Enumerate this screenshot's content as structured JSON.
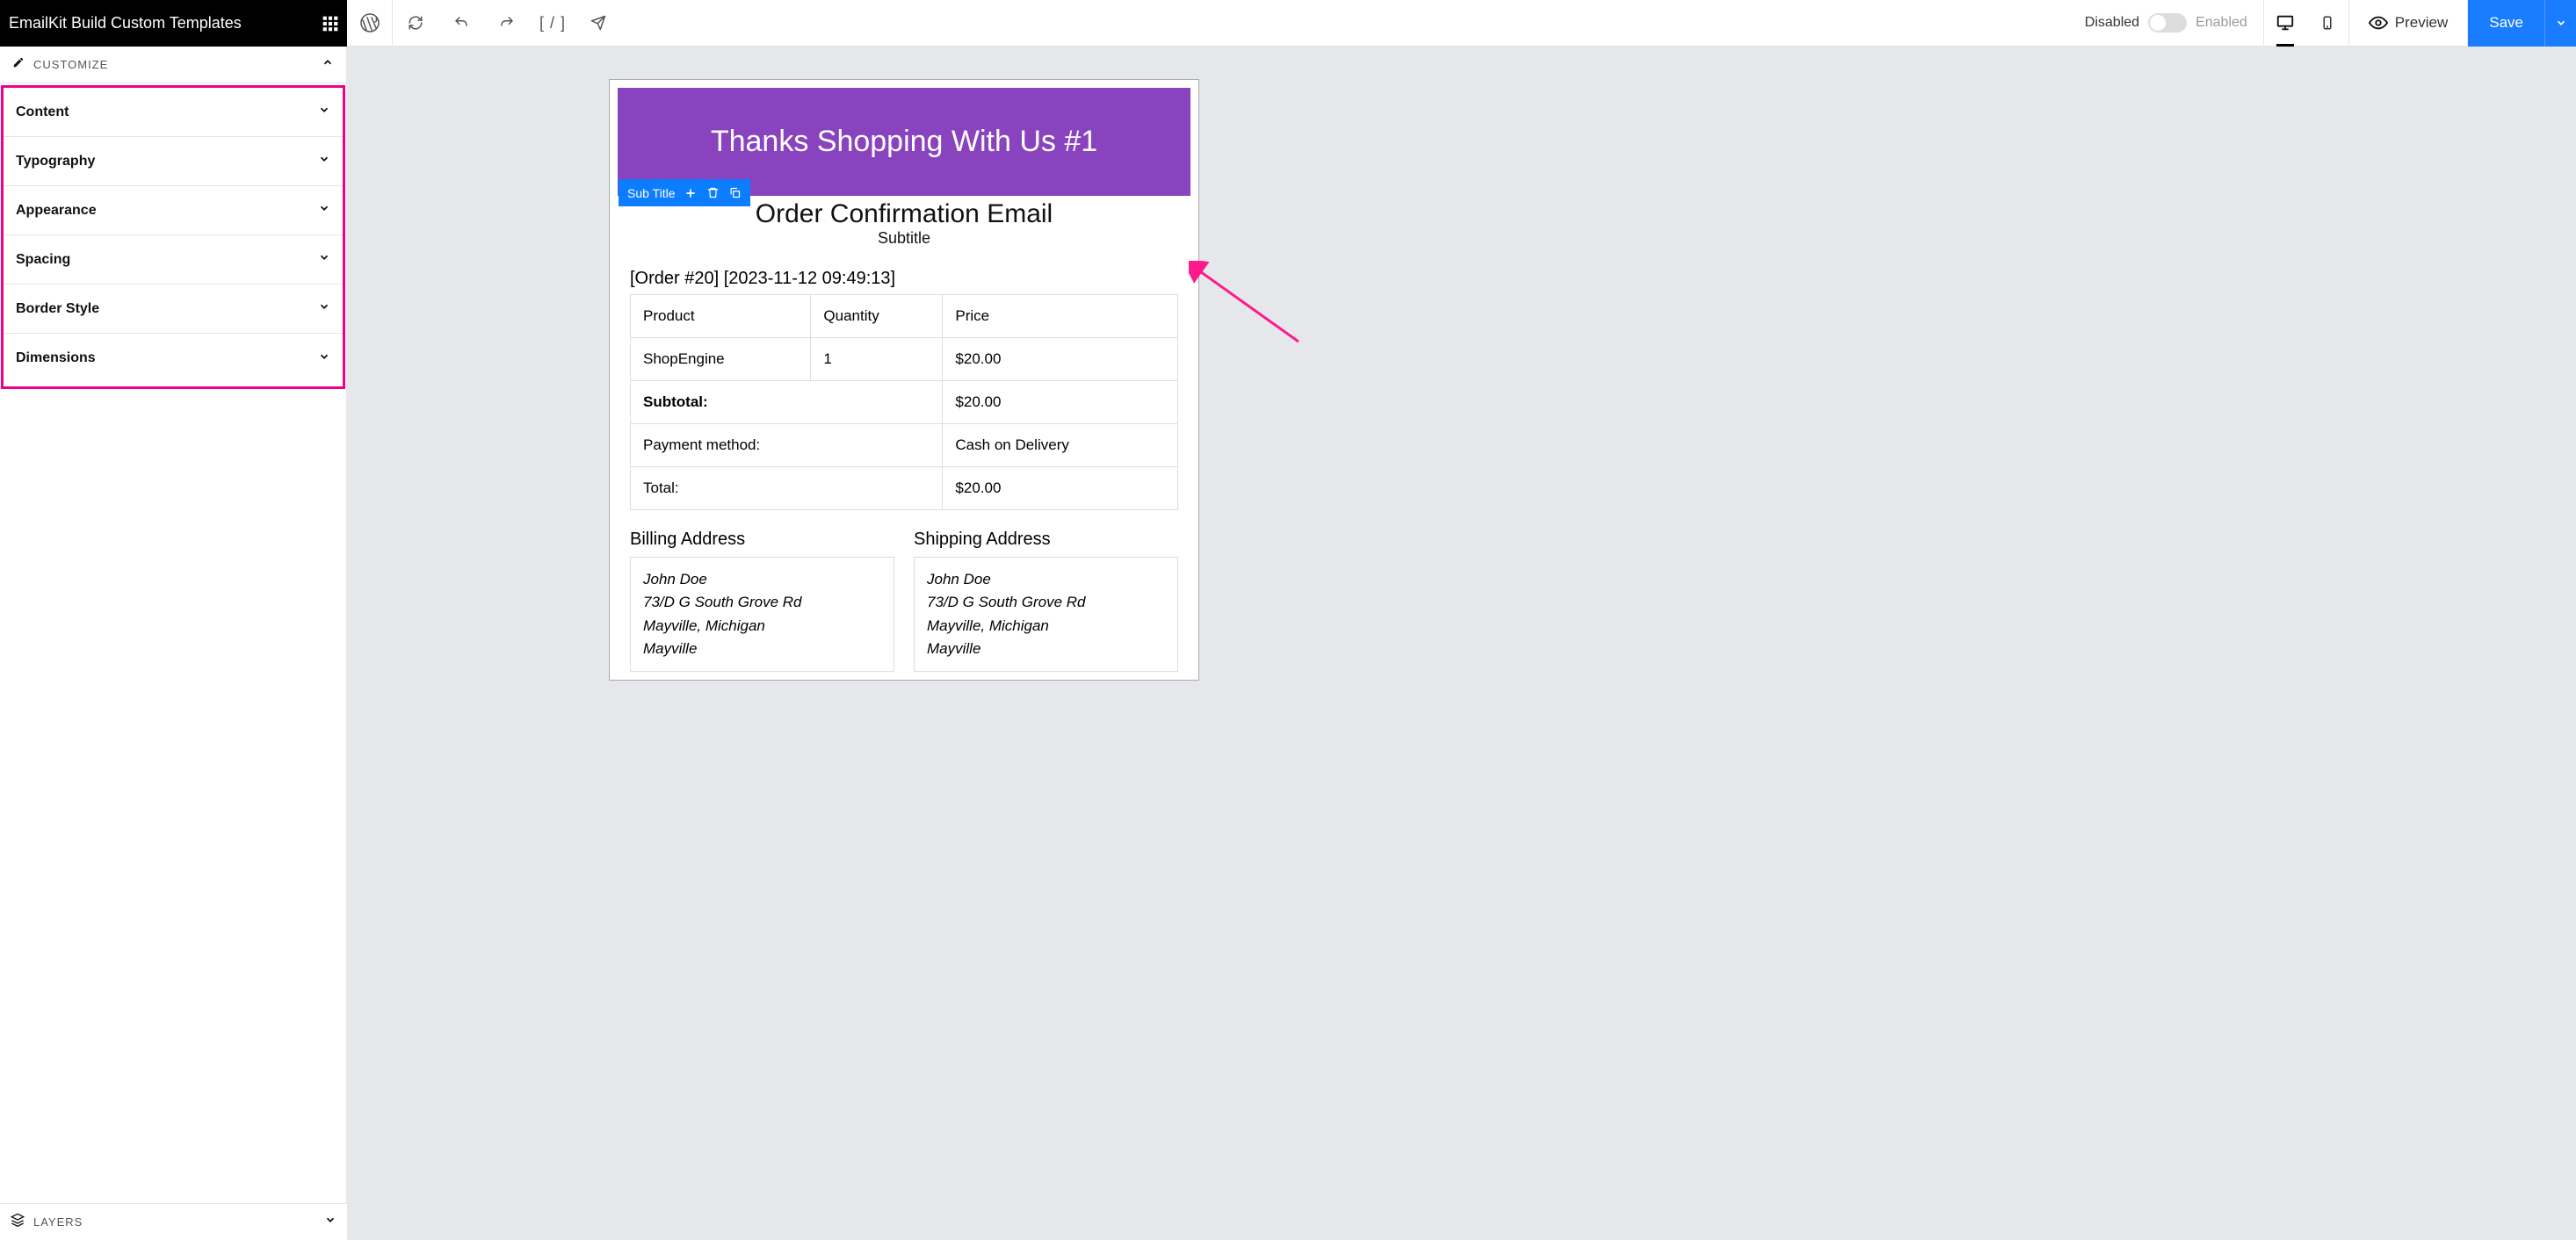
{
  "brand": {
    "title": "EmailKit Build Custom Templates"
  },
  "toolbar": {
    "code": "[ / ]",
    "disabled": "Disabled",
    "enabled": "Enabled",
    "preview": "Preview",
    "save": "Save"
  },
  "sidebar": {
    "customize_label": "CUSTOMIZE",
    "items": [
      "Content",
      "Typography",
      "Appearance",
      "Spacing",
      "Border Style",
      "Dimensions"
    ],
    "layers_label": "LAYERS"
  },
  "email": {
    "header": "Thanks Shopping With Us #1",
    "subtitle_tag": "Sub Title",
    "title": "Order Confirmation Email",
    "subtitle": "Subtitle",
    "order_meta": "[Order #20] [2023-11-12 09:49:13]",
    "table": {
      "head": [
        "Product",
        "Quantity",
        "Price"
      ],
      "row": [
        "ShopEngine",
        "1",
        "$20.00"
      ],
      "subtotal_label": "Subtotal:",
      "subtotal_value": "$20.00",
      "payment_label": "Payment method:",
      "payment_value": "Cash on Delivery",
      "total_label": "Total:",
      "total_value": "$20.00"
    },
    "billing_title": "Billing Address",
    "shipping_title": "Shipping Address",
    "address": {
      "name": "John Doe",
      "street": "73/D G South Grove Rd",
      "city_state": "Mayville, Michigan",
      "city": "Mayville"
    }
  },
  "annotation": {
    "highlight_color": "#ec008c"
  }
}
